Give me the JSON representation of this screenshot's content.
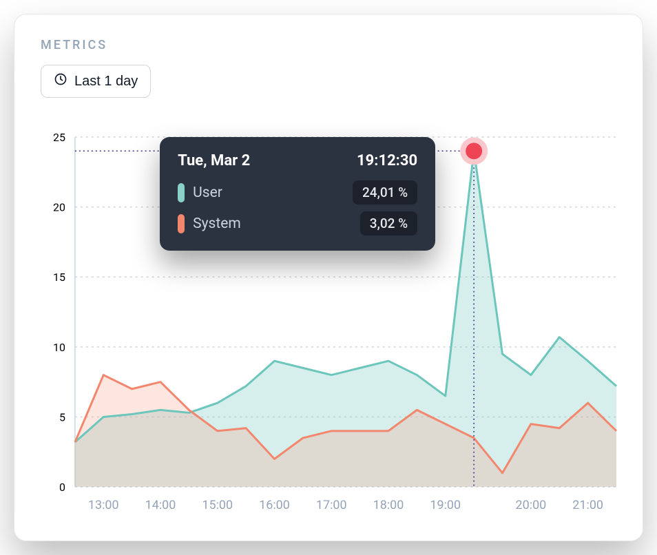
{
  "header": {
    "label": "METRICS",
    "range_button": "Last 1 day"
  },
  "tooltip": {
    "date": "Tue, Mar 2",
    "time": "19:12:30",
    "rows": [
      {
        "name": "User",
        "value": "24,01 %",
        "swatch": "user"
      },
      {
        "name": "System",
        "value": "3,02 %",
        "swatch": "system"
      }
    ]
  },
  "chart_data": {
    "type": "area",
    "title": "",
    "xlabel": "",
    "ylabel": "",
    "ylim": [
      0,
      25
    ],
    "yticks": [
      0,
      5,
      10,
      15,
      20,
      25
    ],
    "xticks": [
      "13:00",
      "14:00",
      "15:00",
      "16:00",
      "17:00",
      "18:00",
      "19:00",
      "20:00",
      "21:00"
    ],
    "x": [
      "12:30",
      "13:00",
      "13:30",
      "14:00",
      "14:30",
      "15:00",
      "15:30",
      "16:00",
      "16:30",
      "17:00",
      "17:30",
      "18:00",
      "18:30",
      "19:00",
      "19:12",
      "19:30",
      "20:00",
      "20:30",
      "21:00",
      "21:30"
    ],
    "series": [
      {
        "name": "User",
        "color": "#6cc6bb",
        "values": [
          3.2,
          5.0,
          5.2,
          5.5,
          5.3,
          6.0,
          7.2,
          9.0,
          8.5,
          8.0,
          8.5,
          9.0,
          8.0,
          6.5,
          24.0,
          9.5,
          8.0,
          10.7,
          9.0,
          7.2
        ]
      },
      {
        "name": "System",
        "color": "#f2876d",
        "values": [
          3.2,
          8.0,
          7.0,
          7.5,
          5.5,
          4.0,
          4.2,
          2.0,
          3.5,
          4.0,
          4.0,
          4.0,
          5.5,
          4.5,
          3.5,
          1.0,
          4.5,
          4.2,
          6.0,
          4.0
        ]
      }
    ],
    "highlight": {
      "x": "19:12",
      "series": "User",
      "value": 24.0
    },
    "legend_position": "tooltip",
    "grid": true
  }
}
